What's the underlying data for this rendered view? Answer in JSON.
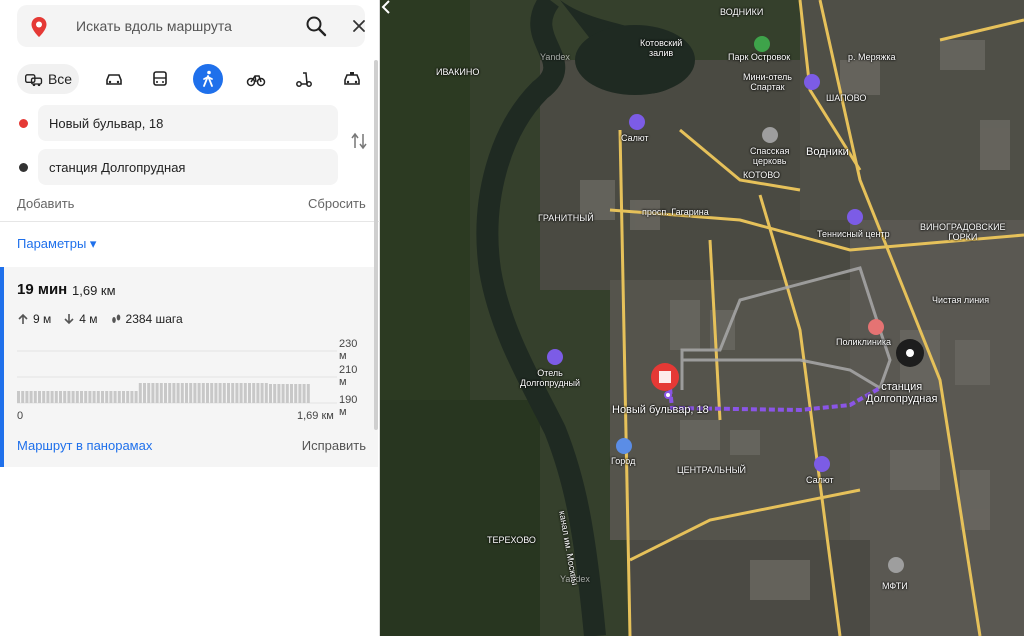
{
  "search": {
    "placeholder": "Искать вдоль маршрута"
  },
  "modes": {
    "all_label": "Все",
    "active": "pedestrian"
  },
  "route_points": {
    "from": "Новый бульвар, 18",
    "to": "станция Долгопрудная"
  },
  "actions": {
    "add": "Добавить",
    "reset": "Сбросить",
    "params": "Параметры ▾"
  },
  "route": {
    "time": "19 мин",
    "distance": "1,69 км",
    "up": "9 м",
    "down": "4 м",
    "steps": "2384 шага",
    "panoramas": "Маршрут в панорамах",
    "fix": "Исправить"
  },
  "elevation": {
    "y_labels": [
      "230 м",
      "210 м",
      "190 м"
    ],
    "x_start": "0",
    "x_end": "1,69 км"
  },
  "colors": {
    "accent": "#1f70eb",
    "start": "#e53935",
    "end": "#333333",
    "route": "#8a55e6"
  },
  "map": {
    "labels": {
      "vodniki_top": "ВОДНИКИ",
      "kotovsky_bay": "Котовский\nзалив",
      "park": "Парк Островок",
      "meryanka": "р. Меряжка",
      "ivakino": "ИВАКИНО",
      "hotel_spartak": "Мини-отель\nСпартак",
      "shapovo": "ШАПОВО",
      "salyut_top": "Салют",
      "church": "Спасская\nцерковь",
      "vodniki_station": "Водники",
      "kotovo": "КОТОВО",
      "granitny": "ГРАНИТНЫЙ",
      "gagarina": "просп. Гагарина",
      "tennis": "Теннисный центр",
      "vinogradovskie": "ВИНОГРАДОВСКИЕ\nГОРКИ",
      "chistaya": "Чистая линия",
      "poliklinika": "Поликлиника",
      "hotel_dolg": "Отель\nДолгопрудный",
      "start_label": "Новый бульвар, 18",
      "station_label": "станция\nДолгопрудная",
      "gorod": "Город",
      "centralny": "ЦЕНТРАЛЬНЫЙ",
      "salyut_bottom": "Салют",
      "terekhovo": "ТЕРЕХОВО",
      "mfti": "МФТИ",
      "yandex_1": "Yandex",
      "yandex_2": "Yandex",
      "kanal": "канал им. Москвы"
    }
  }
}
